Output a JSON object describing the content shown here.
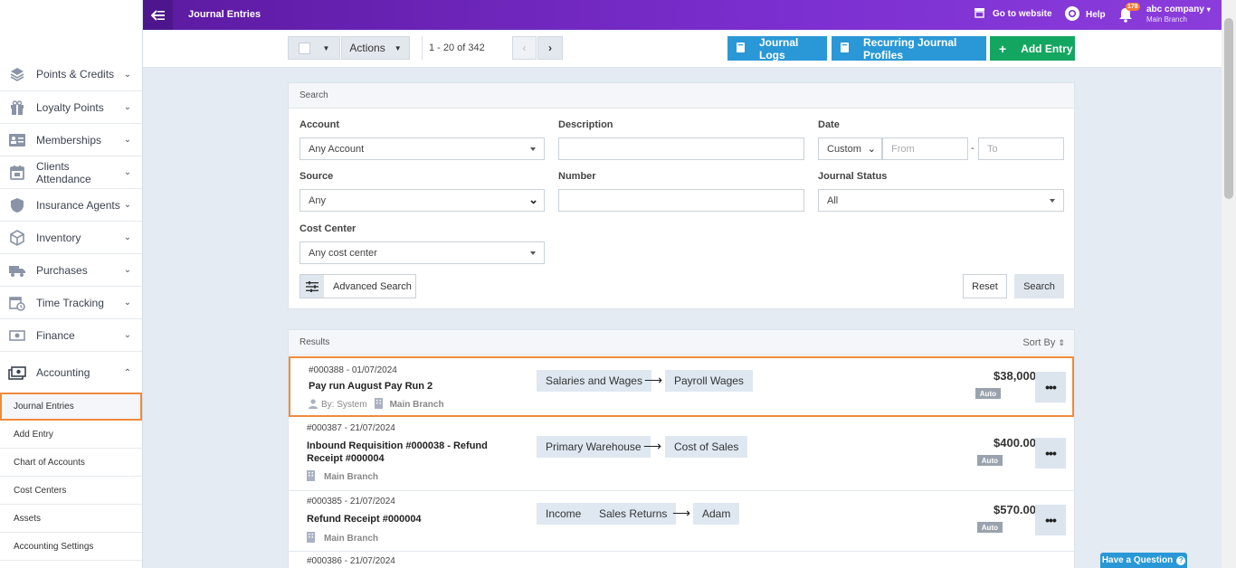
{
  "topbar": {
    "title": "Journal Entries",
    "go_to_website": "Go to website",
    "help": "Help",
    "notification_count": "178",
    "company": "abc company",
    "branch": "Main Branch",
    "gradient_colors": [
      "#5c1aa1",
      "#8a3ddb"
    ]
  },
  "sidebar": {
    "items": [
      {
        "label": "Points & Credits",
        "icon": "stack-icon"
      },
      {
        "label": "Loyalty Points",
        "icon": "gift-icon"
      },
      {
        "label": "Memberships",
        "icon": "membership-card-icon"
      },
      {
        "label": "Clients Attendance",
        "icon": "calendar-icon"
      },
      {
        "label": "Insurance Agents",
        "icon": "shield-icon"
      },
      {
        "label": "Inventory",
        "icon": "box-icon"
      },
      {
        "label": "Purchases",
        "icon": "truck-icon"
      },
      {
        "label": "Time Tracking",
        "icon": "clock-calendar-icon"
      },
      {
        "label": "Finance",
        "icon": "money-icon"
      },
      {
        "label": "Accounting",
        "icon": "accounting-icon"
      }
    ],
    "sub_items": [
      "Journal Entries",
      "Add Entry",
      "Chart of Accounts",
      "Cost Centers",
      "Assets",
      "Accounting Settings"
    ],
    "active_sub_item": "Journal Entries"
  },
  "toolbar": {
    "actions_label": "Actions",
    "pagination": "1 - 20 of 342",
    "journal_logs": "Journal Logs",
    "recurring_profiles": "Recurring Journal Profiles",
    "add_entry": "Add Entry"
  },
  "search": {
    "heading": "Search",
    "account_label": "Account",
    "account_value": "Any Account",
    "description_label": "Description",
    "description_value": "",
    "date_label": "Date",
    "date_mode": "Custom",
    "date_from_placeholder": "From",
    "date_separator": "-",
    "date_to_placeholder": "To",
    "source_label": "Source",
    "source_value": "Any",
    "number_label": "Number",
    "number_value": "",
    "status_label": "Journal Status",
    "status_value": "All",
    "cost_center_label": "Cost Center",
    "cost_center_value": "Any cost center",
    "advanced_search": "Advanced Search",
    "reset": "Reset",
    "search_button": "Search"
  },
  "results": {
    "heading": "Results",
    "sort_by": "Sort By",
    "rows": [
      {
        "number": "#000388 - 01/07/2024",
        "title": "Pay run August Pay Run 2",
        "by": "By: System",
        "branch": "Main Branch",
        "from": [
          "Salaries and Wages"
        ],
        "to": "Payroll Wages",
        "amount": "$38,000",
        "badge": "Auto"
      },
      {
        "number": "#000387 - 21/07/2024",
        "title": "Inbound Requisition #000038 - Refund Receipt #000004",
        "by": "",
        "branch": "Main Branch",
        "from": [
          "Primary Warehouse"
        ],
        "to": "Cost of Sales",
        "amount": "$400.00",
        "badge": "Auto"
      },
      {
        "number": "#000385 - 21/07/2024",
        "title": "Refund Receipt #000004",
        "by": "",
        "branch": "Main Branch",
        "from": [
          "Income",
          "Sales Returns"
        ],
        "to": "Adam",
        "amount": "$570.00",
        "badge": "Auto"
      },
      {
        "number": "#000386 - 21/07/2024"
      }
    ],
    "highlight_color": "#f08a3c"
  },
  "help_widget": {
    "label": "Have a Question"
  }
}
